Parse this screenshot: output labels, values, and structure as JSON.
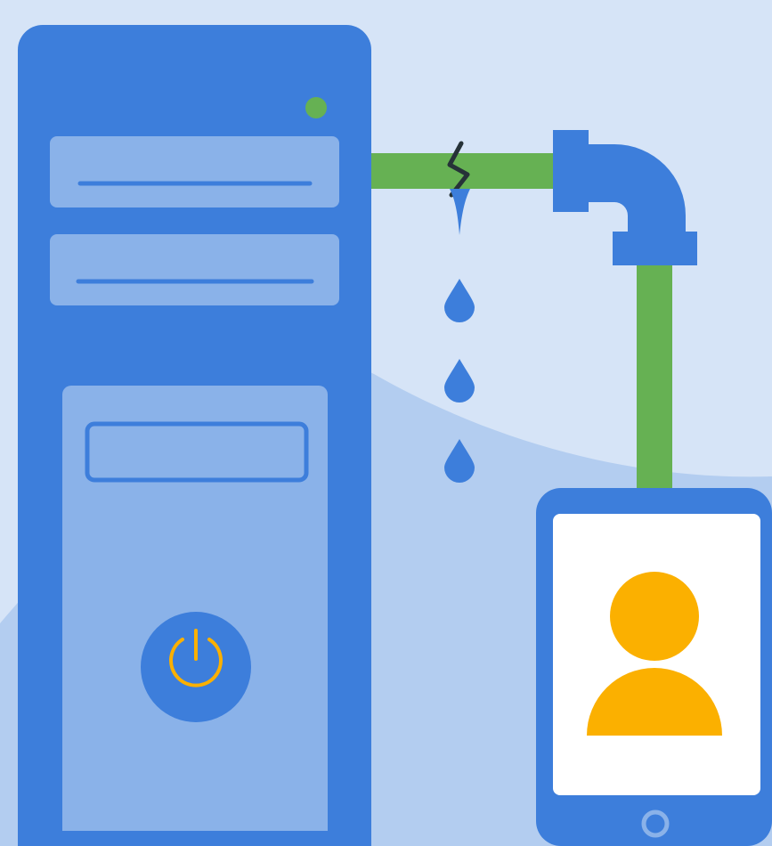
{
  "illustration": {
    "background_color": "#d6e4f7",
    "background_wave_color": "#b3cdf0",
    "primary_blue": "#3d7edb",
    "light_blue": "#8ab2e9",
    "pipe_green": "#66b153",
    "status_led_green": "#66b153",
    "user_yellow": "#fbb000",
    "screen_white": "#ffffff",
    "crack_color": "#263238",
    "icons": [
      "server-tower-icon",
      "power-icon",
      "pipe-icon",
      "water-drop-icon",
      "phone-icon",
      "user-icon"
    ]
  }
}
